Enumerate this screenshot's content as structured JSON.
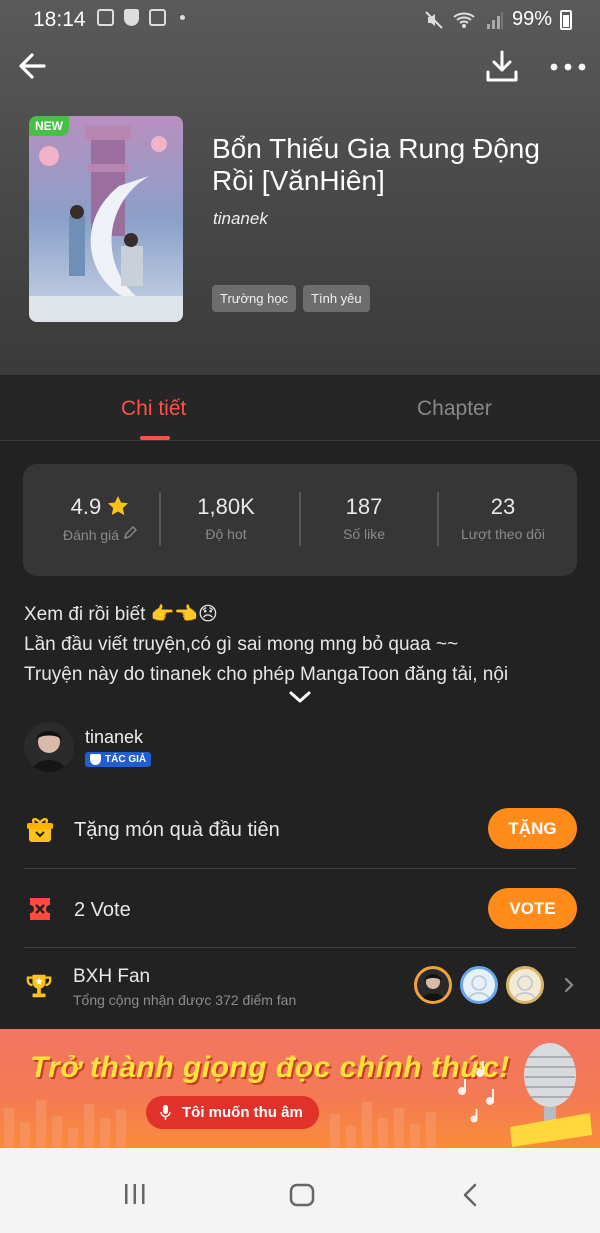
{
  "status_bar": {
    "time": "18:14",
    "battery": "99%"
  },
  "book": {
    "badge": "NEW",
    "title": "Bổn Thiếu Gia Rung Động Rồi [VănHiên]",
    "author": "tinanek",
    "tags": [
      "Trường học",
      "Tình yêu"
    ]
  },
  "tabs": {
    "active": "Chi tiết",
    "inactive": "Chapter"
  },
  "stats": {
    "rating": {
      "value": "4.9",
      "label": "Đánh giá"
    },
    "hot": {
      "value": "1,80K",
      "label": "Độ hot"
    },
    "likes": {
      "value": "187",
      "label": "Số like"
    },
    "follows": {
      "value": "23",
      "label": "Lượt theo dõi"
    }
  },
  "description": {
    "line1": "Xem đi rồi biết 👉👈😞",
    "line2": "Lần đầu viết truyện,có gì sai mong mng bỏ quaa ~~",
    "line3": "Truyện này do tinanek cho phép MangaToon đăng tải, nội"
  },
  "author_row": {
    "name": "tinanek",
    "badge": "TÁC GIẢ"
  },
  "gift": {
    "label": "Tặng món quà đầu tiên",
    "button": "TẶNG"
  },
  "vote": {
    "label": "2 Vote",
    "button": "VOTE"
  },
  "fan": {
    "title": "BXH Fan",
    "subtitle": "Tổng cộng nhận được 372 điểm fan"
  },
  "banner": {
    "headline": "Trở thành giọng đọc chính thức!",
    "button": "Tôi muốn thu âm"
  },
  "colors": {
    "accent": "#ff5148",
    "button": "#ff8c1a",
    "badge_new": "#47c045"
  }
}
